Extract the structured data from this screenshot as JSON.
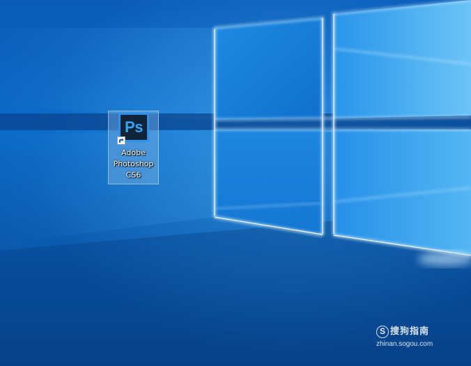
{
  "desktop": {
    "icons": [
      {
        "label_lines": [
          "Adobe",
          "Photoshop",
          "CS6"
        ],
        "logo_text": "Ps",
        "icon": "photoshop-icon",
        "shortcut_overlay": "shortcut-arrow-icon",
        "selected": true
      }
    ]
  },
  "watermark": {
    "logo_letter": "S",
    "title": "搜狗指南",
    "url": "zhinan.sogou.com"
  },
  "colors": {
    "wallpaper_base": "#0b5fb5",
    "wallpaper_light": "#7fd2ff",
    "icon_selection": "#8cbeeb",
    "ps_background": "#11243a",
    "ps_accent": "#2d92e8"
  }
}
